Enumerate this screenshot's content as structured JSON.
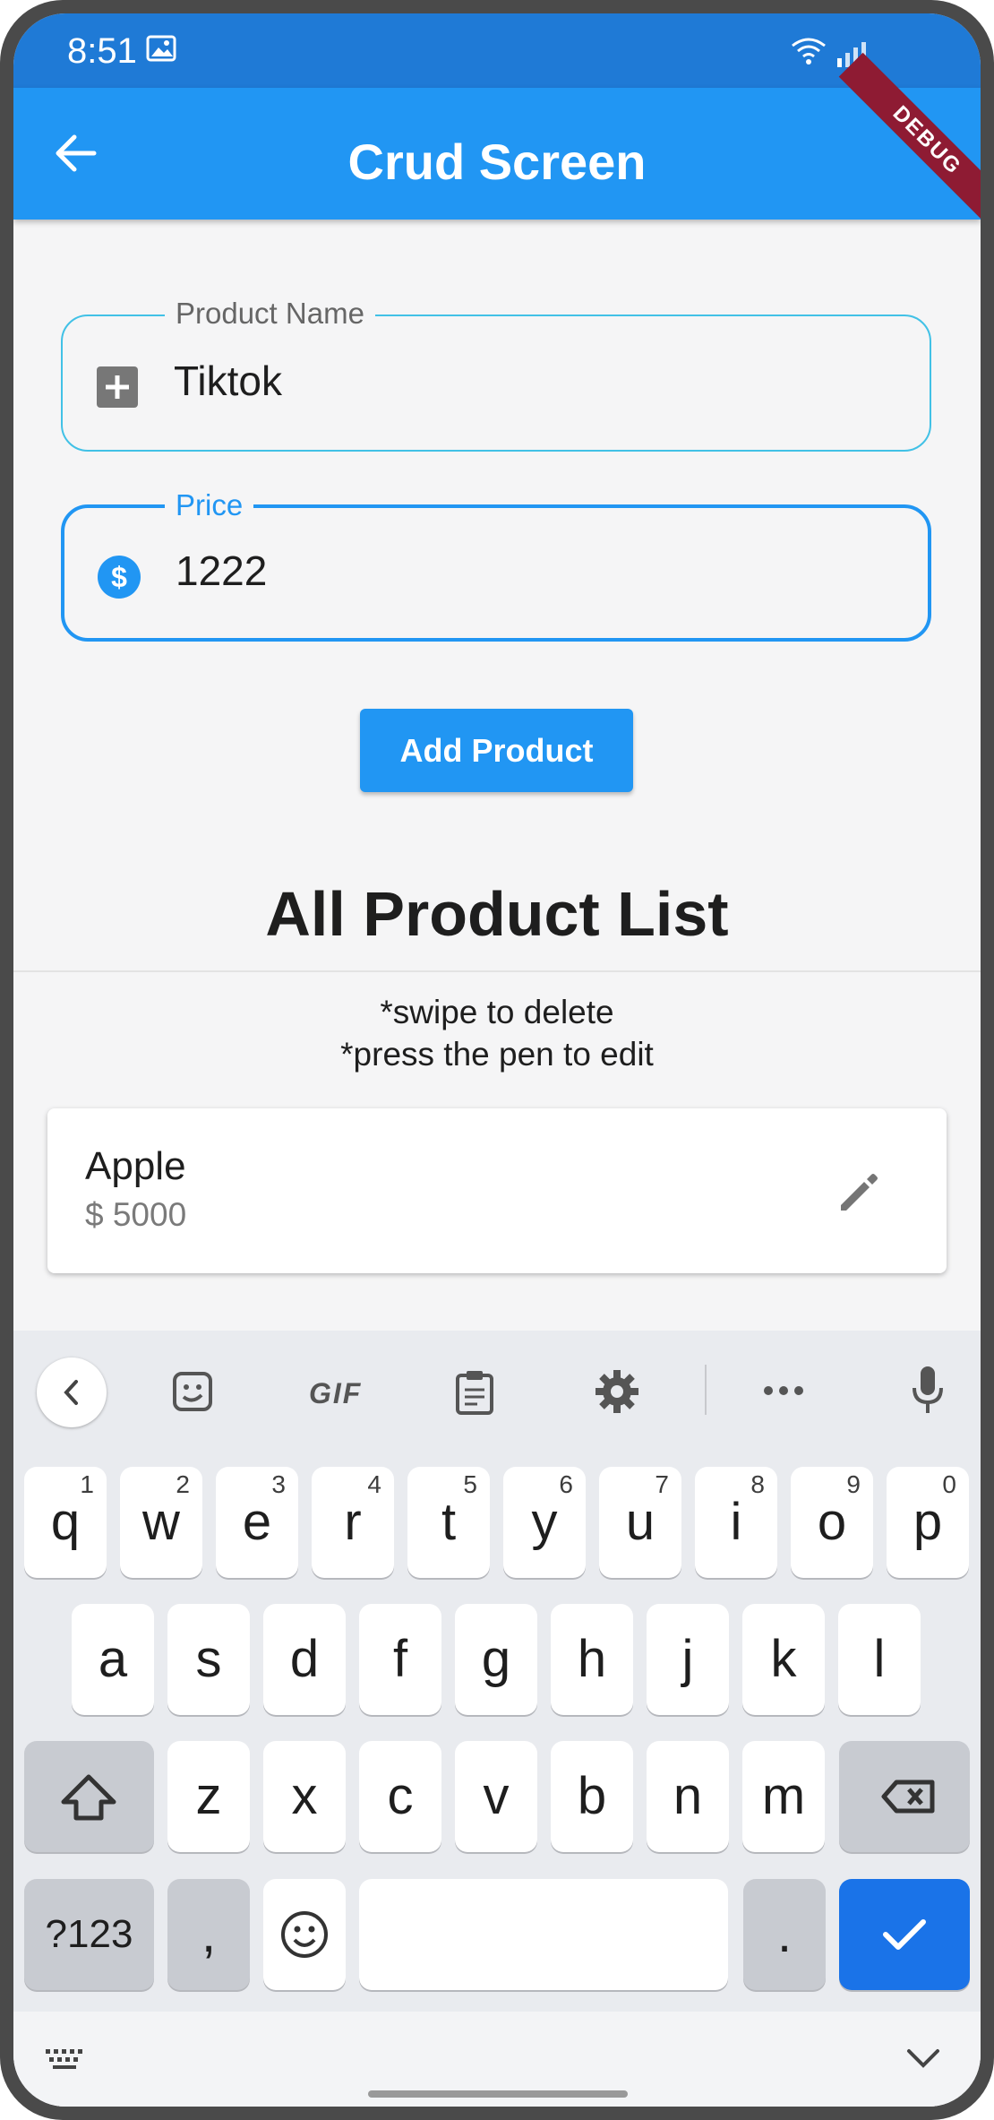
{
  "status_bar": {
    "time": "8:51"
  },
  "app_bar": {
    "title": "Crud Screen",
    "debug_banner": "DEBUG"
  },
  "form": {
    "product_name": {
      "label": "Product Name",
      "value": "Tiktok"
    },
    "price": {
      "label": "Price",
      "value": "1222"
    },
    "submit_label": "Add Product"
  },
  "list": {
    "title": "All Product List",
    "hint_swipe": "*swipe to delete",
    "hint_edit": "*press the pen to edit",
    "items": [
      {
        "name": "Apple",
        "price": "$ 5000"
      }
    ]
  },
  "keyboard": {
    "toolbar": [
      "back",
      "sticker",
      "GIF",
      "clipboard",
      "settings",
      "more",
      "mic"
    ],
    "gif_label": "GIF",
    "row1": [
      {
        "key": "q",
        "hint": "1"
      },
      {
        "key": "w",
        "hint": "2"
      },
      {
        "key": "e",
        "hint": "3"
      },
      {
        "key": "r",
        "hint": "4"
      },
      {
        "key": "t",
        "hint": "5"
      },
      {
        "key": "y",
        "hint": "6"
      },
      {
        "key": "u",
        "hint": "7"
      },
      {
        "key": "i",
        "hint": "8"
      },
      {
        "key": "o",
        "hint": "9"
      },
      {
        "key": "p",
        "hint": "0"
      }
    ],
    "row2": [
      "a",
      "s",
      "d",
      "f",
      "g",
      "h",
      "j",
      "k",
      "l"
    ],
    "row3": [
      "z",
      "x",
      "c",
      "v",
      "b",
      "n",
      "m"
    ],
    "symbols_label": "?123",
    "comma": ",",
    "period": ".",
    "accent_color": "#1a73e8"
  }
}
